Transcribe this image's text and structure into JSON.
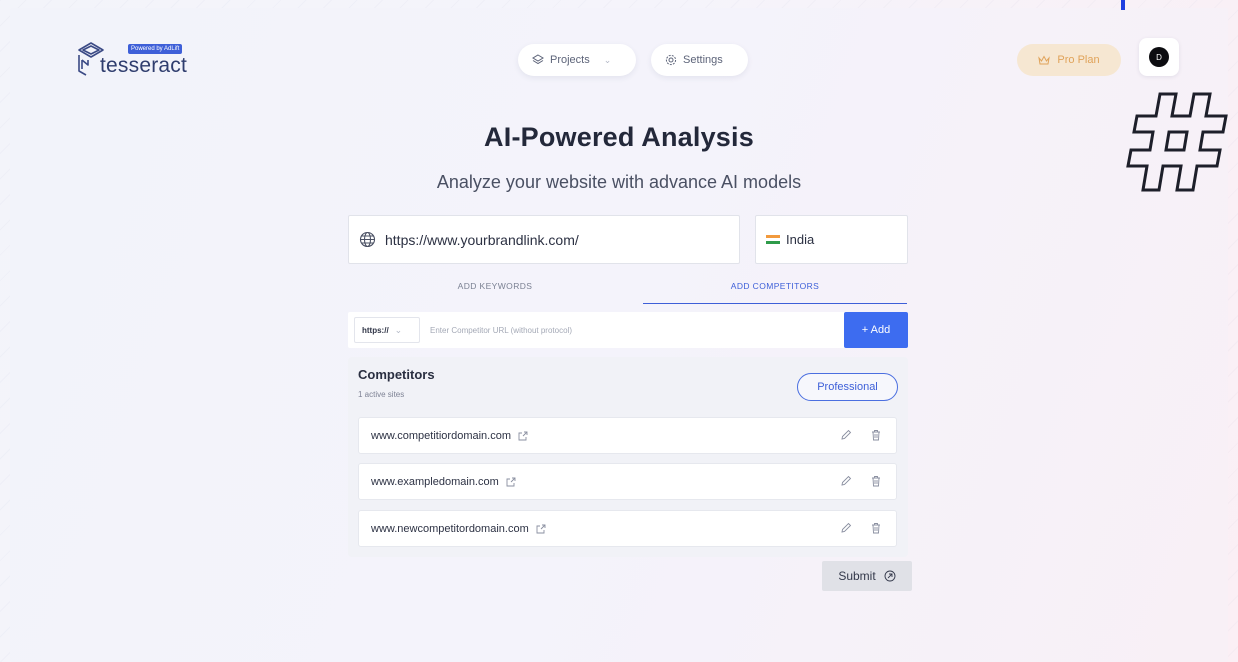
{
  "brand": {
    "badge": "Powered by AdLift",
    "name": "tesseract"
  },
  "nav": {
    "projects_label": "Projects",
    "settings_label": "Settings"
  },
  "account": {
    "plan_label": "Pro Plan",
    "avatar_initial": "D"
  },
  "hero": {
    "title": "AI-Powered Analysis",
    "subtitle": "Analyze your website with advance AI models"
  },
  "form": {
    "url_value": "https://www.yourbrandlink.com/",
    "country": "India"
  },
  "tabs": [
    {
      "label": "ADD KEYWORDS",
      "active": false
    },
    {
      "label": "ADD COMPETITORS",
      "active": true
    }
  ],
  "competitor_input": {
    "protocol": "https://",
    "placeholder": "Enter Competitor URL (without protocol)",
    "add_label": "+ Add"
  },
  "competitors": {
    "heading": "Competitors",
    "count_label": "1 active sites",
    "plan_badge": "Professional",
    "items": [
      {
        "domain": "www.competitiordomain.com"
      },
      {
        "domain": "www.exampledomain.com"
      },
      {
        "domain": "www.newcompetitordomain.com"
      }
    ]
  },
  "submit_label": "Submit",
  "colors": {
    "accent": "#3d6cf0",
    "tab_active": "#3d5fd8",
    "pro_plan_bg": "#f6e7d2",
    "pro_plan_text": "#e0a35a"
  },
  "icons": {
    "globe": "globe-icon",
    "layers": "layers-icon",
    "gear": "gear-icon",
    "crown": "crown-icon",
    "external_link": "external-link-icon",
    "edit": "pencil-icon",
    "delete": "trash-icon",
    "submit_arrow": "arrow-circle-icon"
  }
}
